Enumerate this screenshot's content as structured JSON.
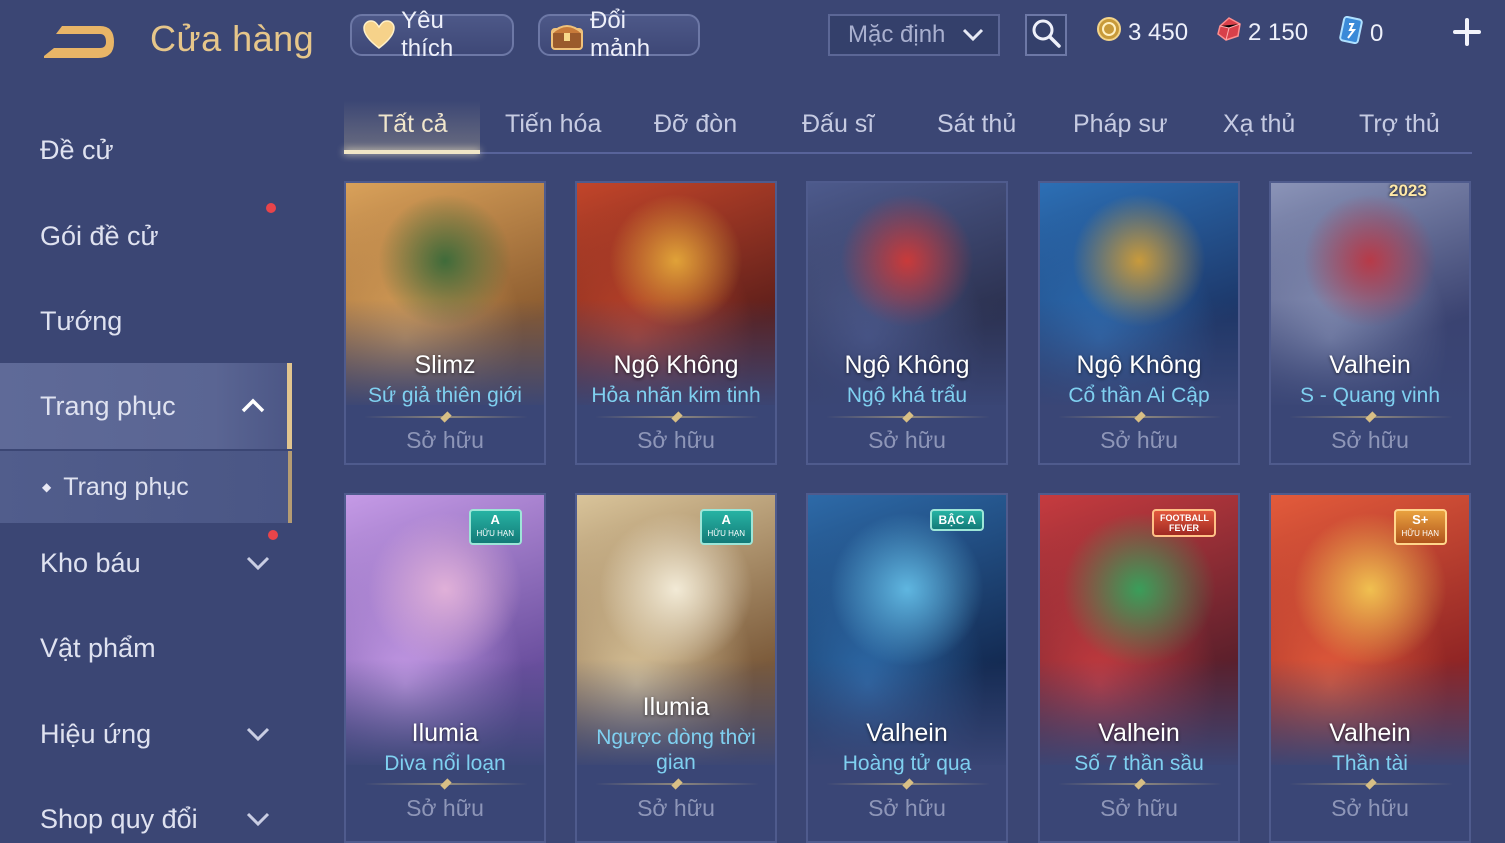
{
  "header": {
    "title": "Cửa hàng",
    "favorites_label": "Yêu thích",
    "shard_exchange_label": "Đổi mảnh",
    "sort_value": "Mặc định"
  },
  "currency": {
    "gold": "3 450",
    "ruby": "2 150",
    "voucher": "0"
  },
  "sidebar": {
    "items": [
      {
        "label": "Đề cử"
      },
      {
        "label": "Gói đề cử"
      },
      {
        "label": "Tướng"
      },
      {
        "label": "Trang phục"
      },
      {
        "label": "Trang phục"
      },
      {
        "label": "Kho báu"
      },
      {
        "label": "Vật phẩm"
      },
      {
        "label": "Hiệu ứng"
      },
      {
        "label": "Shop quy đổi"
      }
    ]
  },
  "tabs": [
    {
      "label": "Tất cả"
    },
    {
      "label": "Tiến hóa"
    },
    {
      "label": "Đỡ đòn"
    },
    {
      "label": "Đấu sĩ"
    },
    {
      "label": "Sát thủ"
    },
    {
      "label": "Pháp sư"
    },
    {
      "label": "Xạ thủ"
    },
    {
      "label": "Trợ thủ"
    }
  ],
  "skins": [
    {
      "hero": "Slimz",
      "skin": "Sứ giả thiên giới",
      "status": "Sở hữu",
      "badge": "",
      "art": [
        "#d9a15a",
        "#8a5a2e",
        "#3f6b3a"
      ]
    },
    {
      "hero": "Ngộ Không",
      "skin": "Hỏa nhãn kim tinh",
      "status": "Sở hữu",
      "badge": "",
      "art": [
        "#c2452a",
        "#5c1e1a",
        "#e0a238"
      ]
    },
    {
      "hero": "Ngộ Không",
      "skin": "Ngộ khá trẩu",
      "status": "Sở hữu",
      "badge": "",
      "art": [
        "#4d5a8c",
        "#2a2f4d",
        "#c93a3a"
      ]
    },
    {
      "hero": "Ngộ Không",
      "skin": "Cổ thần Ai Cập",
      "status": "Sở hữu",
      "badge": "",
      "art": [
        "#2c6fb5",
        "#1c3566",
        "#c89a3c"
      ]
    },
    {
      "hero": "Valhein",
      "skin": "S - Quang vinh",
      "status": "Sở hữu",
      "badge": "2023",
      "art": [
        "#8b94b8",
        "#3a4270",
        "#b73a48"
      ]
    },
    {
      "hero": "Ilumia",
      "skin": "Diva nổi loạn",
      "status": "Sở hữu",
      "badge": "A",
      "badge_sub": "HỮU HẠN",
      "art": [
        "#c59ae6",
        "#6a4f9e",
        "#e0b0d8"
      ]
    },
    {
      "hero": "Ilumia",
      "skin": "Ngược dòng thời gian",
      "status": "Sở hữu",
      "badge": "A",
      "badge_sub": "HỮU HẠN",
      "art": [
        "#d9c49a",
        "#7b5a3a",
        "#f2ead6"
      ]
    },
    {
      "hero": "Valhein",
      "skin": "Hoàng tử quạ",
      "status": "Sở hữu",
      "badge": "BẬC A",
      "art": [
        "#2d6aa8",
        "#132a52",
        "#5fb6e0"
      ]
    },
    {
      "hero": "Valhein",
      "skin": "Số 7 thần sầu",
      "status": "Sở hữu",
      "badge": "FOOTBALL FEVER",
      "art": [
        "#c63b3f",
        "#5a1f2b",
        "#3a9e5a"
      ]
    },
    {
      "hero": "Valhein",
      "skin": "Thần tài",
      "status": "Sở hữu",
      "badge": "S+",
      "badge_sub": "HỮU HẠN",
      "art": [
        "#e35b3b",
        "#8f2424",
        "#f0c050"
      ]
    }
  ]
}
